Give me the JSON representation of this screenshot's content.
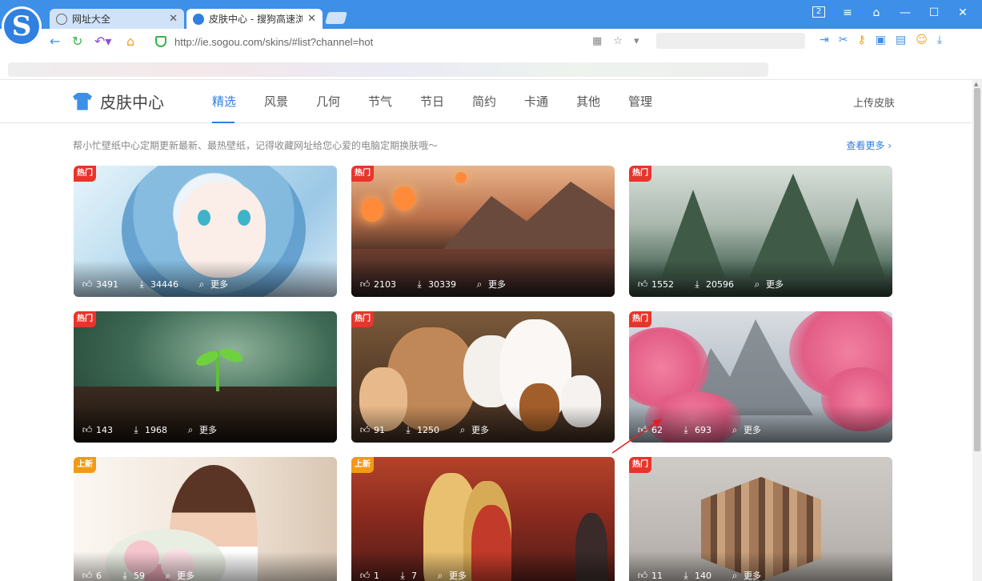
{
  "browser": {
    "tabs": [
      {
        "label": "网址大全",
        "active": false
      },
      {
        "label": "皮肤中心 - 搜狗高速浏览",
        "active": true
      }
    ],
    "url": "http://ie.sogou.com/skins/#list?channel=hot",
    "window_controls": [
      "2",
      "≡",
      "⌂",
      "—",
      "☐",
      "✕"
    ]
  },
  "site": {
    "title": "皮肤中心",
    "nav": [
      "精选",
      "风景",
      "几何",
      "节气",
      "节日",
      "简约",
      "卡通",
      "其他",
      "管理"
    ],
    "active_nav": "精选",
    "upload_label": "上传皮肤",
    "notice": "帮小忙壁纸中心定期更新最新、最热壁纸，记得收藏网址给您心爱的电脑定期换肤哦～",
    "see_more": "查看更多"
  },
  "cards": [
    {
      "badge": "热门",
      "badge_type": "hot",
      "likes": "3491",
      "downloads": "34446",
      "more": "更多",
      "theme": "anime-girl-blue-hair-icon"
    },
    {
      "badge": "热门",
      "badge_type": "hot",
      "likes": "2103",
      "downloads": "30339",
      "more": "更多",
      "theme": "lantern-village-sunset-icon"
    },
    {
      "badge": "热门",
      "badge_type": "hot",
      "likes": "1552",
      "downloads": "20596",
      "more": "更多",
      "theme": "misty-mountains-icon"
    },
    {
      "badge": "热门",
      "badge_type": "hot",
      "likes": "143",
      "downloads": "1968",
      "more": "更多",
      "theme": "sprout-soil-icon"
    },
    {
      "badge": "热门",
      "badge_type": "hot",
      "likes": "91",
      "downloads": "1250",
      "more": "更多",
      "theme": "cartoon-pets-icon"
    },
    {
      "badge": "热门",
      "badge_type": "hot",
      "likes": "62",
      "downloads": "693",
      "more": "更多",
      "theme": "cherry-blossom-icon"
    },
    {
      "badge": "上新",
      "badge_type": "new",
      "likes": "6",
      "downloads": "59",
      "more": "更多",
      "theme": "woman-flowers-icon"
    },
    {
      "badge": "上新",
      "badge_type": "new",
      "likes": "1",
      "downloads": "7",
      "more": "更多",
      "theme": "anime-restaurant-icon"
    },
    {
      "badge": "热门",
      "badge_type": "hot",
      "likes": "11",
      "downloads": "140",
      "more": "更多",
      "theme": "wooden-cube-icon"
    }
  ],
  "colors": {
    "accent": "#2f80e0",
    "hot_badge": "#e8352b",
    "new_badge": "#f29a17",
    "titlebar": "#3d8fe8"
  }
}
